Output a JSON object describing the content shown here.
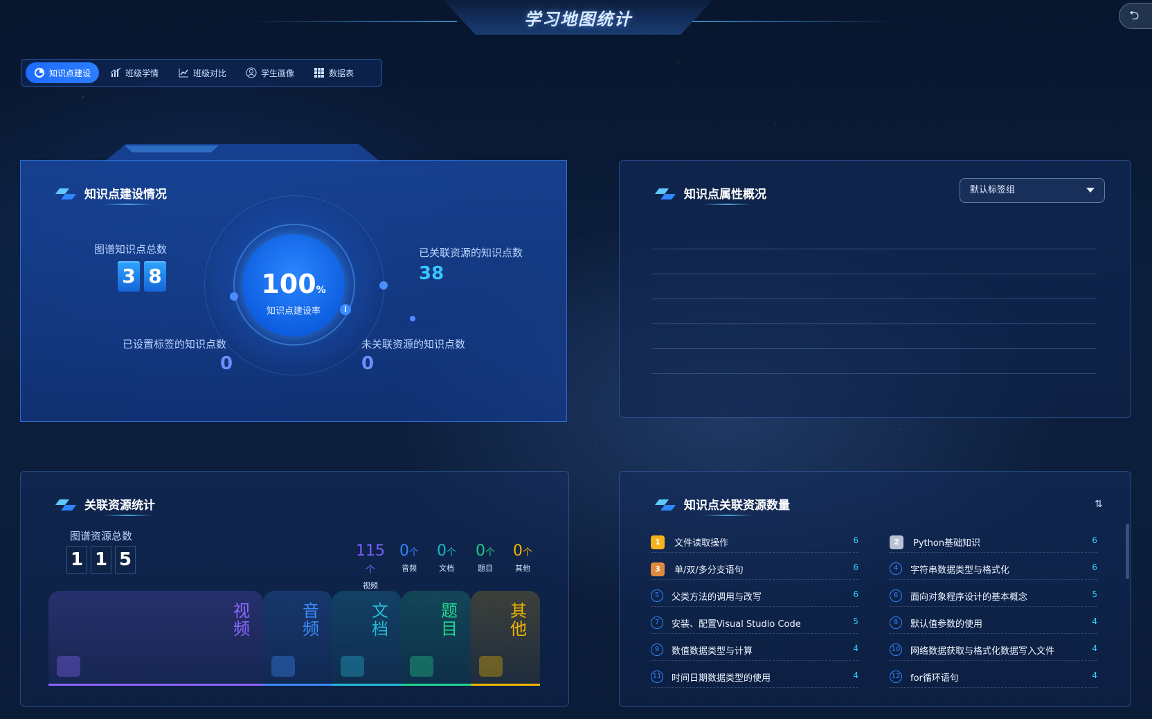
{
  "header": {
    "title": "学习地图统计",
    "back_label": "⮌"
  },
  "nav": {
    "tabs": [
      {
        "label": "知识点建设",
        "active": true,
        "icon": "pie-icon"
      },
      {
        "label": "班级学情",
        "active": false,
        "icon": "bar-chart-icon"
      },
      {
        "label": "班级对比",
        "active": false,
        "icon": "line-chart-icon"
      },
      {
        "label": "学生画像",
        "active": false,
        "icon": "user-circle-icon"
      },
      {
        "label": "数据表",
        "active": false,
        "icon": "grid-icon"
      }
    ]
  },
  "build": {
    "title": "知识点建设情况",
    "total_label": "图谱知识点总数",
    "total_digits": [
      "3",
      "8"
    ],
    "linked_label": "已关联资源的知识点数",
    "linked_value": "38",
    "tagged_label": "已设置标签的知识点数",
    "tagged_value": "0",
    "unlinked_label": "未关联资源的知识点数",
    "unlinked_value": "0",
    "rate_value": "100",
    "rate_unit": "%",
    "rate_label": "知识点建设率",
    "info": "i"
  },
  "attributes": {
    "title": "知识点属性概况",
    "select_value": "默认标签组"
  },
  "resources": {
    "title": "关联资源统计",
    "total_label": "图谱资源总数",
    "total_digits": [
      "1",
      "1",
      "5"
    ],
    "stats": [
      {
        "value": "115",
        "unit": "个",
        "label": "视频",
        "color": "#7b5cff"
      },
      {
        "value": "0",
        "unit": "个",
        "label": "音频",
        "color": "#2f86ff"
      },
      {
        "value": "0",
        "unit": "个",
        "label": "文档",
        "color": "#1fb7c8"
      },
      {
        "value": "0",
        "unit": "个",
        "label": "题目",
        "color": "#1ecb8c"
      },
      {
        "value": "0",
        "unit": "个",
        "label": "其他",
        "color": "#f0b400"
      }
    ],
    "cards": [
      {
        "name": "视频",
        "color": "#8a66ff"
      },
      {
        "name": "音频",
        "color": "#3d8bff"
      },
      {
        "name": "文档",
        "color": "#27b9d6"
      },
      {
        "name": "题目",
        "color": "#22d48f"
      },
      {
        "name": "其他",
        "color": "#f2b600"
      }
    ]
  },
  "ranking": {
    "title": "知识点关联资源数量",
    "items": [
      {
        "rank": "1",
        "name": "文件读取操作",
        "count": "6"
      },
      {
        "rank": "2",
        "name": "Python基础知识",
        "count": "6"
      },
      {
        "rank": "3",
        "name": "单/双/多分支语句",
        "count": "6"
      },
      {
        "rank": "4",
        "name": "字符串数据类型与格式化",
        "count": "6"
      },
      {
        "rank": "5",
        "name": "父类方法的调用与改写",
        "count": "6"
      },
      {
        "rank": "6",
        "name": "面向对象程序设计的基本概念",
        "count": "5"
      },
      {
        "rank": "7",
        "name": "安装、配置Visual Studio Code",
        "count": "5"
      },
      {
        "rank": "8",
        "name": "默认值参数的使用",
        "count": "4"
      },
      {
        "rank": "9",
        "name": "数值数据类型与计算",
        "count": "4"
      },
      {
        "rank": "10",
        "name": "网络数据获取与格式化数据写入文件",
        "count": "4"
      },
      {
        "rank": "11",
        "name": "时间日期数据类型的使用",
        "count": "4"
      },
      {
        "rank": "12",
        "name": "for循环语句",
        "count": "4"
      }
    ]
  }
}
